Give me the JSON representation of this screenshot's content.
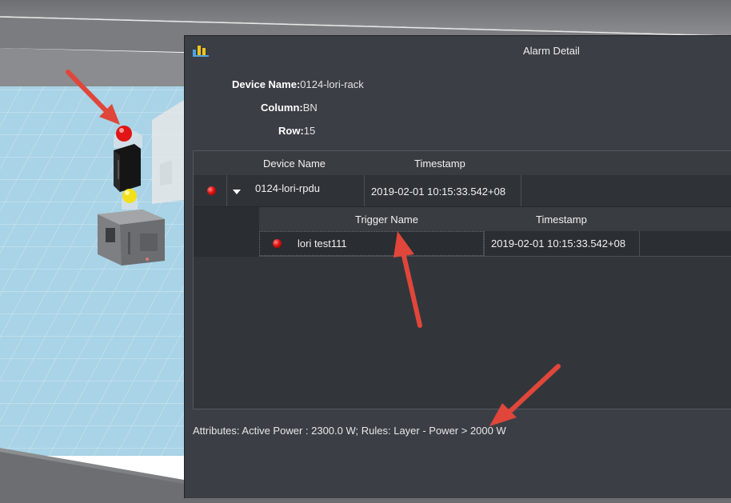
{
  "dialog": {
    "title": "Alarm Detail",
    "device_name_label": "Device Name:",
    "device_name_value": "0124-lori-rack",
    "column_label": "Column:",
    "column_value": "BN",
    "row_label": "Row:",
    "row_value": "15"
  },
  "alarm_table": {
    "headers": {
      "device_name": "Device Name",
      "timestamp": "Timestamp"
    },
    "row": {
      "status": "red",
      "device_name": "0124-lori-rpdu",
      "timestamp": "2019-02-01 10:15:33.542+08"
    }
  },
  "trigger_table": {
    "headers": {
      "trigger_name": "Trigger Name",
      "timestamp": "Timestamp"
    },
    "row": {
      "status": "red",
      "trigger_name": "lori test111",
      "timestamp": "2019-02-01 10:15:33.542+08"
    }
  },
  "attributes_text": "Attributes: Active Power : 2300.0 W; Rules: Layer - Power > 2000 W",
  "colors": {
    "dialog_bg": "#3b3f45",
    "table_bg": "#32363b",
    "alarm_red": "#e01010",
    "annotation_arrow": "#e0463a",
    "floor_tile": "#a9d1e3"
  },
  "icons": [
    "chart-bar-icon",
    "red-status-led-icon",
    "expand-caret-icon"
  ]
}
